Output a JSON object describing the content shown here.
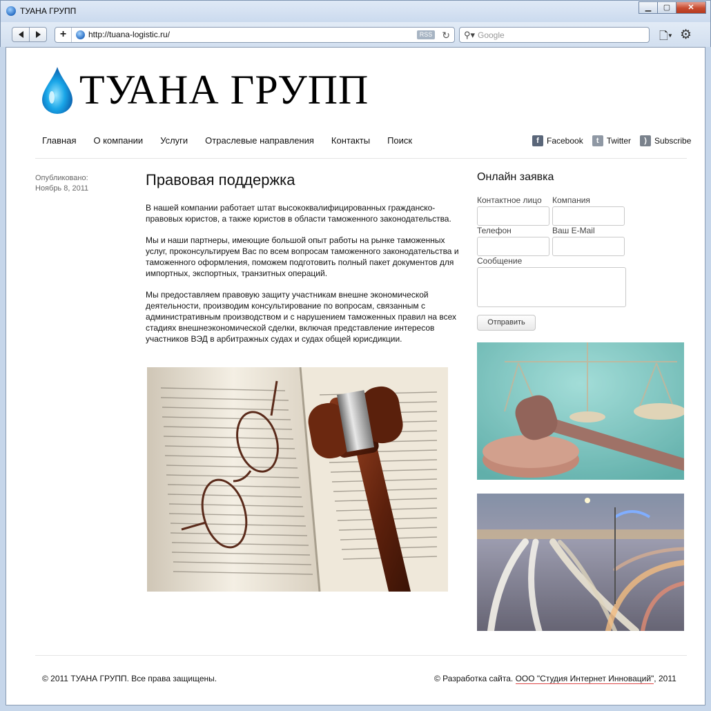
{
  "browser": {
    "window_title": "ТУАНА ГРУПП",
    "url": "http://tuana-logistic.ru/",
    "rss_badge": "RSS",
    "search_placeholder": "Google"
  },
  "site": {
    "logo_text": "ТУАНА ГРУПП",
    "nav": [
      "Главная",
      "О компании",
      "Услуги",
      "Отраслевые направления",
      "Контакты",
      "Поиск"
    ],
    "social": [
      {
        "label": "Facebook",
        "icon": "facebook-icon"
      },
      {
        "label": "Twitter",
        "icon": "twitter-icon"
      },
      {
        "label": "Subscribe",
        "icon": "rss-icon"
      }
    ]
  },
  "post": {
    "published_label": "Опубликовано:",
    "published_date": "Ноябрь 8, 2011",
    "title": "Правовая поддержка",
    "paragraphs": [
      "В нашей компании работает штат высококвалифицированных гражданско-правовых юристов, а также юристов в области таможенного законодательства.",
      "Мы и наши партнеры, имеющие большой опыт работы на рынке таможенных услуг, проконсультируем Вас по всем вопросам таможенного законодательства и таможенного оформления, поможем подготовить полный пакет документов для импортных, экспортных, транзитных операций.",
      "Мы предоставляем правовую защиту участникам внешне экономической деятельности, производим консультирование по вопросам, связанным с административным производством и с нарушением таможенных правил на всех стадиях внешнеэкономической сделки, включая представление интересов участников ВЭД в арбитражных судах и судах общей юрисдикции."
    ]
  },
  "form": {
    "title": "Онлайн заявка",
    "contact_label": "Контактное лицо",
    "company_label": "Компания",
    "phone_label": "Телефон",
    "email_label": "Ваш E-Mail",
    "message_label": "Сообщение",
    "submit_label": "Отправить"
  },
  "footer": {
    "copyright": "© 2011 ТУАНА ГРУПП. Все права защищены.",
    "dev_prefix": "© Разработка сайта. ",
    "dev_link": "ООО \"Студия Интернет Инноваций\"",
    "dev_suffix": ", 2011"
  }
}
